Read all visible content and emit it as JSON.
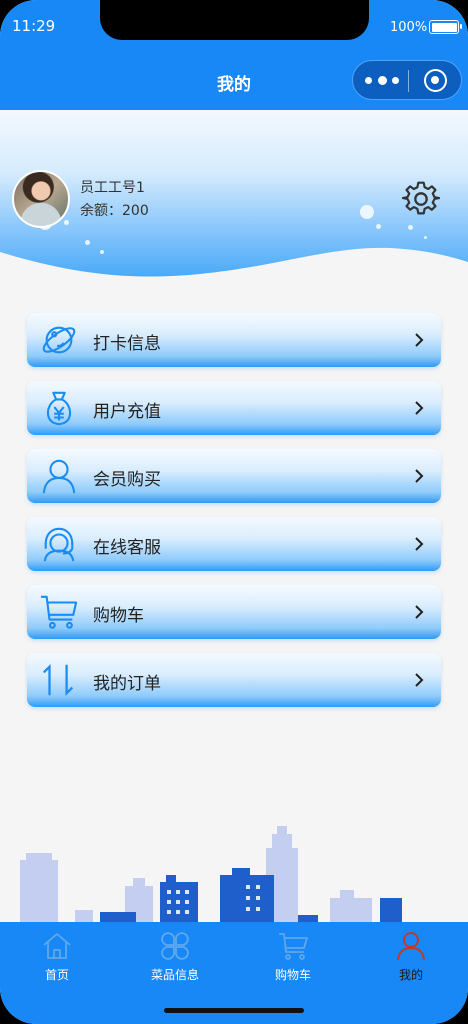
{
  "status_bar": {
    "time": "11:29",
    "battery": "100%"
  },
  "nav": {
    "title": "我的"
  },
  "user": {
    "name": "员工工号1",
    "balance": "余额：200"
  },
  "menu": [
    {
      "label": "打卡信息",
      "icon": "planet-icon"
    },
    {
      "label": "用户充值",
      "icon": "money-bag-icon"
    },
    {
      "label": "会员购买",
      "icon": "user-icon"
    },
    {
      "label": "在线客服",
      "icon": "headset-icon"
    },
    {
      "label": "购物车",
      "icon": "cart-icon"
    },
    {
      "label": "我的订单",
      "icon": "sort-arrows-icon"
    }
  ],
  "tabbar": [
    {
      "label": "首页",
      "icon": "home-icon"
    },
    {
      "label": "菜品信息",
      "icon": "clover-icon"
    },
    {
      "label": "购物车",
      "icon": "cart-icon"
    },
    {
      "label": "我的",
      "icon": "user-icon",
      "active": true
    }
  ],
  "colors": {
    "primary": "#1888f7",
    "icon_blue": "#1a8cf2",
    "active_tab": "#c0392b"
  }
}
